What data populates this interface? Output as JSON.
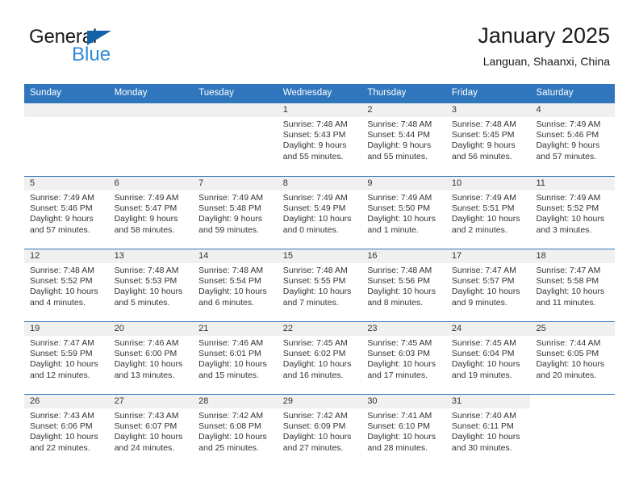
{
  "brand": {
    "word_one": "General",
    "word_two": "Blue",
    "flag_icon": "blue-triangle-flag-icon"
  },
  "header": {
    "title": "January 2025",
    "subtitle": "Languan, Shaanxi, China"
  },
  "calendar": {
    "weekdays": [
      "Sunday",
      "Monday",
      "Tuesday",
      "Wednesday",
      "Thursday",
      "Friday",
      "Saturday"
    ],
    "header_bg": "#3076bc",
    "band_bg": "#f0f0f0",
    "weeks": [
      [
        {
          "date": "",
          "empty": true
        },
        {
          "date": "",
          "empty": true
        },
        {
          "date": "",
          "empty": true
        },
        {
          "date": "1",
          "sunrise": "Sunrise: 7:48 AM",
          "sunset": "Sunset: 5:43 PM",
          "daylight": "Daylight: 9 hours and 55 minutes."
        },
        {
          "date": "2",
          "sunrise": "Sunrise: 7:48 AM",
          "sunset": "Sunset: 5:44 PM",
          "daylight": "Daylight: 9 hours and 55 minutes."
        },
        {
          "date": "3",
          "sunrise": "Sunrise: 7:48 AM",
          "sunset": "Sunset: 5:45 PM",
          "daylight": "Daylight: 9 hours and 56 minutes."
        },
        {
          "date": "4",
          "sunrise": "Sunrise: 7:49 AM",
          "sunset": "Sunset: 5:46 PM",
          "daylight": "Daylight: 9 hours and 57 minutes."
        }
      ],
      [
        {
          "date": "5",
          "sunrise": "Sunrise: 7:49 AM",
          "sunset": "Sunset: 5:46 PM",
          "daylight": "Daylight: 9 hours and 57 minutes."
        },
        {
          "date": "6",
          "sunrise": "Sunrise: 7:49 AM",
          "sunset": "Sunset: 5:47 PM",
          "daylight": "Daylight: 9 hours and 58 minutes."
        },
        {
          "date": "7",
          "sunrise": "Sunrise: 7:49 AM",
          "sunset": "Sunset: 5:48 PM",
          "daylight": "Daylight: 9 hours and 59 minutes."
        },
        {
          "date": "8",
          "sunrise": "Sunrise: 7:49 AM",
          "sunset": "Sunset: 5:49 PM",
          "daylight": "Daylight: 10 hours and 0 minutes."
        },
        {
          "date": "9",
          "sunrise": "Sunrise: 7:49 AM",
          "sunset": "Sunset: 5:50 PM",
          "daylight": "Daylight: 10 hours and 1 minute."
        },
        {
          "date": "10",
          "sunrise": "Sunrise: 7:49 AM",
          "sunset": "Sunset: 5:51 PM",
          "daylight": "Daylight: 10 hours and 2 minutes."
        },
        {
          "date": "11",
          "sunrise": "Sunrise: 7:49 AM",
          "sunset": "Sunset: 5:52 PM",
          "daylight": "Daylight: 10 hours and 3 minutes."
        }
      ],
      [
        {
          "date": "12",
          "sunrise": "Sunrise: 7:48 AM",
          "sunset": "Sunset: 5:52 PM",
          "daylight": "Daylight: 10 hours and 4 minutes."
        },
        {
          "date": "13",
          "sunrise": "Sunrise: 7:48 AM",
          "sunset": "Sunset: 5:53 PM",
          "daylight": "Daylight: 10 hours and 5 minutes."
        },
        {
          "date": "14",
          "sunrise": "Sunrise: 7:48 AM",
          "sunset": "Sunset: 5:54 PM",
          "daylight": "Daylight: 10 hours and 6 minutes."
        },
        {
          "date": "15",
          "sunrise": "Sunrise: 7:48 AM",
          "sunset": "Sunset: 5:55 PM",
          "daylight": "Daylight: 10 hours and 7 minutes."
        },
        {
          "date": "16",
          "sunrise": "Sunrise: 7:48 AM",
          "sunset": "Sunset: 5:56 PM",
          "daylight": "Daylight: 10 hours and 8 minutes."
        },
        {
          "date": "17",
          "sunrise": "Sunrise: 7:47 AM",
          "sunset": "Sunset: 5:57 PM",
          "daylight": "Daylight: 10 hours and 9 minutes."
        },
        {
          "date": "18",
          "sunrise": "Sunrise: 7:47 AM",
          "sunset": "Sunset: 5:58 PM",
          "daylight": "Daylight: 10 hours and 11 minutes."
        }
      ],
      [
        {
          "date": "19",
          "sunrise": "Sunrise: 7:47 AM",
          "sunset": "Sunset: 5:59 PM",
          "daylight": "Daylight: 10 hours and 12 minutes."
        },
        {
          "date": "20",
          "sunrise": "Sunrise: 7:46 AM",
          "sunset": "Sunset: 6:00 PM",
          "daylight": "Daylight: 10 hours and 13 minutes."
        },
        {
          "date": "21",
          "sunrise": "Sunrise: 7:46 AM",
          "sunset": "Sunset: 6:01 PM",
          "daylight": "Daylight: 10 hours and 15 minutes."
        },
        {
          "date": "22",
          "sunrise": "Sunrise: 7:45 AM",
          "sunset": "Sunset: 6:02 PM",
          "daylight": "Daylight: 10 hours and 16 minutes."
        },
        {
          "date": "23",
          "sunrise": "Sunrise: 7:45 AM",
          "sunset": "Sunset: 6:03 PM",
          "daylight": "Daylight: 10 hours and 17 minutes."
        },
        {
          "date": "24",
          "sunrise": "Sunrise: 7:45 AM",
          "sunset": "Sunset: 6:04 PM",
          "daylight": "Daylight: 10 hours and 19 minutes."
        },
        {
          "date": "25",
          "sunrise": "Sunrise: 7:44 AM",
          "sunset": "Sunset: 6:05 PM",
          "daylight": "Daylight: 10 hours and 20 minutes."
        }
      ],
      [
        {
          "date": "26",
          "sunrise": "Sunrise: 7:43 AM",
          "sunset": "Sunset: 6:06 PM",
          "daylight": "Daylight: 10 hours and 22 minutes."
        },
        {
          "date": "27",
          "sunrise": "Sunrise: 7:43 AM",
          "sunset": "Sunset: 6:07 PM",
          "daylight": "Daylight: 10 hours and 24 minutes."
        },
        {
          "date": "28",
          "sunrise": "Sunrise: 7:42 AM",
          "sunset": "Sunset: 6:08 PM",
          "daylight": "Daylight: 10 hours and 25 minutes."
        },
        {
          "date": "29",
          "sunrise": "Sunrise: 7:42 AM",
          "sunset": "Sunset: 6:09 PM",
          "daylight": "Daylight: 10 hours and 27 minutes."
        },
        {
          "date": "30",
          "sunrise": "Sunrise: 7:41 AM",
          "sunset": "Sunset: 6:10 PM",
          "daylight": "Daylight: 10 hours and 28 minutes."
        },
        {
          "date": "31",
          "sunrise": "Sunrise: 7:40 AM",
          "sunset": "Sunset: 6:11 PM",
          "daylight": "Daylight: 10 hours and 30 minutes."
        },
        {
          "date": "",
          "blank": true
        }
      ]
    ]
  }
}
